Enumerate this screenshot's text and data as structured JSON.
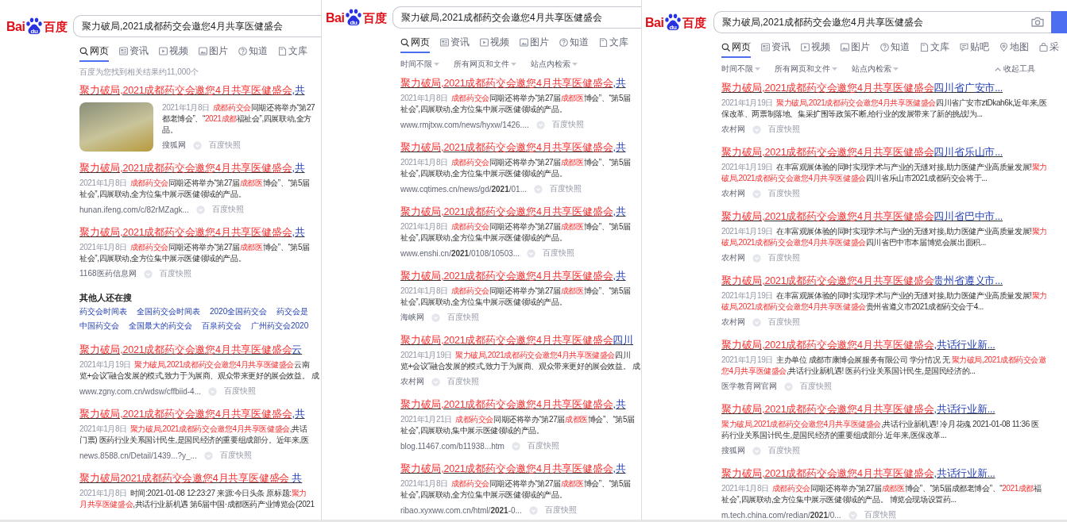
{
  "panels": [
    {
      "logo": {
        "latin": "Bai",
        "paw": "du",
        "chinese": "百度"
      },
      "search": {
        "value": "聚力破局,2021成都药交会邀您4月共享医健盛会"
      },
      "tabs": [
        {
          "label": "网页",
          "selected": true
        },
        {
          "label": "资讯",
          "selected": false
        },
        {
          "label": "视频",
          "selected": false
        },
        {
          "label": "图片",
          "selected": false
        },
        {
          "label": "知道",
          "selected": false
        },
        {
          "label": "文库",
          "selected": false
        }
      ],
      "result_count": "百度为您找到相关结果约11,000个",
      "items": [
        {
          "kind": "result",
          "title": [
            {
              "text": "聚力破局,2021成都药交会邀您4月共享医健盛会",
              "kind": "highlight"
            },
            {
              "text": ",共",
              "kind": "plain"
            }
          ],
          "thumbnail": true,
          "lines": [
            [
              {
                "text": "2021年1月8日",
                "kind": "date"
              },
              {
                "text": "成都药交会",
                "kind": "highlight"
              },
              {
                "text": "同期还将举办“第27",
                "kind": "plain"
              }
            ],
            [
              {
                "text": "都老博会”、“",
                "kind": "plain"
              },
              {
                "text": "2021成都",
                "kind": "highlight"
              },
              {
                "text": "福祉会”,四展联动,全方",
                "kind": "plain"
              }
            ],
            [
              {
                "text": "品。",
                "kind": "plain"
              }
            ]
          ],
          "source": "搜狐网",
          "snapshot": "百度快照"
        },
        {
          "kind": "result",
          "title": [
            {
              "text": "聚力破局,2021成都药交会邀您4月共享医健盛会",
              "kind": "highlight"
            },
            {
              "text": ",共",
              "kind": "plain"
            }
          ],
          "lines": [
            [
              {
                "text": "2021年1月8日",
                "kind": "date"
              },
              {
                "text": "成都药交会",
                "kind": "highlight"
              },
              {
                "text": "同期还将举办“第27届",
                "kind": "plain"
              },
              {
                "text": "成都医",
                "kind": "highlight"
              },
              {
                "text": "博会”、“第5届",
                "kind": "plain"
              }
            ],
            [
              {
                "text": "祉会”,四展联动,全方位集中展示医健领域的产品。",
                "kind": "plain"
              }
            ]
          ],
          "source": "hunan.ifeng.com/c/82rMZagk...",
          "snapshot": "百度快照"
        },
        {
          "kind": "result",
          "title": [
            {
              "text": "聚力破局,2021成都药交会邀您4月共享医健盛会",
              "kind": "highlight"
            },
            {
              "text": ",共",
              "kind": "plain"
            }
          ],
          "lines": [
            [
              {
                "text": "2021年1月8日",
                "kind": "date"
              },
              {
                "text": "成都药交会",
                "kind": "highlight"
              },
              {
                "text": "同期还将举办“第27届",
                "kind": "plain"
              },
              {
                "text": "成都医",
                "kind": "highlight"
              },
              {
                "text": "博会”、“第5届",
                "kind": "plain"
              }
            ],
            [
              {
                "text": "祉会”,四展联动,全方位集中展示医健领域的产品。",
                "kind": "plain"
              }
            ]
          ],
          "source": "1168医药信息网",
          "snapshot": "百度快照"
        },
        {
          "kind": "related",
          "heading": "其他人还在搜",
          "rows": [
            [
              "药交会时间表",
              "全国药交会时间表",
              "2020全国药交会",
              "药交会是"
            ],
            [
              "中国药交会",
              "全国最大的药交会",
              "百泉药交会",
              "广州药交会2020"
            ]
          ]
        },
        {
          "kind": "result",
          "title": [
            {
              "text": "聚力破局,2021成都药交会邀您4月共享医健盛会",
              "kind": "highlight"
            },
            {
              "text": "云",
              "kind": "plain"
            }
          ],
          "lines": [
            [
              {
                "text": "2021年1月19日",
                "kind": "date"
              },
              {
                "text": "聚力破局,2021成都药交会邀您4月共享医健盛会",
                "kind": "highlight"
              },
              {
                "text": "云南",
                "kind": "plain"
              }
            ],
            [
              {
                "text": "览+会议”融合发展的模式,致力于为展商、观众带来更好的展会效益。 成",
                "kind": "plain"
              }
            ]
          ],
          "source": "www.zgny.com.cn/wdsw/cffbiid-4...",
          "snapshot": "百度快照"
        },
        {
          "kind": "result",
          "title": [
            {
              "text": "聚力破局,2021成都药交会邀您4月共享医健盛会",
              "kind": "highlight"
            },
            {
              "text": ",共",
              "kind": "plain"
            }
          ],
          "lines": [
            [
              {
                "text": "2021年1月8日",
                "kind": "date"
              },
              {
                "text": "聚力破局,2021成都药交会邀您4月共享医健盛会",
                "kind": "highlight"
              },
              {
                "text": ",共话",
                "kind": "plain"
              }
            ],
            [
              {
                "text": "门票) 医药行业关系国计民生,是国民经济的重要组成部分。近年来,医",
                "kind": "plain"
              }
            ]
          ],
          "source": "news.8588.cn/Detail/1439...?y_...",
          "snapshot": "百度快照"
        },
        {
          "kind": "result",
          "title": [
            {
              "text": "聚力破局2021成都药交会邀您4月共享医健盛会",
              "kind": "highlight"
            },
            {
              "text": " 共",
              "kind": "plain"
            }
          ],
          "lines": [
            [
              {
                "text": "2021年1月8日",
                "kind": "date"
              },
              {
                "text": "时间:2021-01-08 12:23:27 来源:今日头条 原标题:",
                "kind": "plain"
              },
              {
                "text": "聚力",
                "kind": "highlight"
              }
            ],
            [
              {
                "text": "月共享医健盛会",
                "kind": "highlight"
              },
              {
                "text": ",共话行业新机遇 第6届中国·成都医药产业博览会(2021",
                "kind": "plain"
              }
            ]
          ]
        }
      ]
    },
    {
      "logo": {
        "latin": "Bai",
        "paw": "du",
        "chinese": "百度"
      },
      "search": {
        "value": "聚力破局,2021成都药交会邀您4月共享医健盛会"
      },
      "tabs": [
        {
          "label": "网页",
          "selected": true
        },
        {
          "label": "资讯",
          "selected": false
        },
        {
          "label": "视频",
          "selected": false
        },
        {
          "label": "图片",
          "selected": false
        },
        {
          "label": "知道",
          "selected": false
        },
        {
          "label": "文库",
          "selected": false
        }
      ],
      "filters": [
        "时间不限",
        "所有网页和文件",
        "站点内检索"
      ],
      "items": [
        {
          "kind": "result",
          "title": [
            {
              "text": "聚力破局,2021成都药交会邀您4月共享医健盛会",
              "kind": "highlight"
            },
            {
              "text": ",共",
              "kind": "plain"
            }
          ],
          "lines": [
            [
              {
                "text": "2021年1月8日",
                "kind": "date"
              },
              {
                "text": "成都药交会",
                "kind": "highlight"
              },
              {
                "text": "同期还将举办“第27届",
                "kind": "plain"
              },
              {
                "text": "成都医",
                "kind": "highlight"
              },
              {
                "text": "博会”、“第5届",
                "kind": "plain"
              }
            ],
            [
              {
                "text": "祉会”,四展联动,全方位集中展示医健领域的产品。",
                "kind": "plain"
              }
            ]
          ],
          "source": "www.rmjtxw.com/news/hyxw/1426....",
          "snapshot": "百度快照"
        },
        {
          "kind": "result",
          "title": [
            {
              "text": "聚力破局,2021成都药交会邀您4月共享医健盛会",
              "kind": "highlight"
            },
            {
              "text": ",共",
              "kind": "plain"
            }
          ],
          "lines": [
            [
              {
                "text": "2021年1月8日",
                "kind": "date"
              },
              {
                "text": "成都药交会",
                "kind": "highlight"
              },
              {
                "text": "同期还将举办“第27届",
                "kind": "plain"
              },
              {
                "text": "成都医",
                "kind": "highlight"
              },
              {
                "text": "博会”、“第5届",
                "kind": "plain"
              }
            ],
            [
              {
                "text": "祉会”,四展联动,全方位集中展示医健领域的产品。",
                "kind": "plain"
              }
            ]
          ],
          "source": "www.cqtimes.cn/news/gd/**2021**/01...",
          "snapshot": "百度快照"
        },
        {
          "kind": "result",
          "title": [
            {
              "text": "聚力破局,2021成都药交会邀您4月共享医健盛会",
              "kind": "highlight"
            },
            {
              "text": ",共",
              "kind": "plain"
            }
          ],
          "lines": [
            [
              {
                "text": "2021年1月8日",
                "kind": "date"
              },
              {
                "text": "成都药交会",
                "kind": "highlight"
              },
              {
                "text": "同期还将举办“第27届",
                "kind": "plain"
              },
              {
                "text": "成都医",
                "kind": "highlight"
              },
              {
                "text": "博会”、“第5届",
                "kind": "plain"
              }
            ],
            [
              {
                "text": "祉会”,四展联动,全方位集中展示医健领域的产品。",
                "kind": "plain"
              }
            ]
          ],
          "source": "www.enshi.cn/**2021**/0108/10503...",
          "snapshot": "百度快照"
        },
        {
          "kind": "result",
          "title": [
            {
              "text": "聚力破局,2021成都药交会邀您4月共享医健盛会",
              "kind": "highlight"
            },
            {
              "text": ",共",
              "kind": "plain"
            }
          ],
          "lines": [
            [
              {
                "text": "2021年1月8日",
                "kind": "date"
              },
              {
                "text": "成都药交会",
                "kind": "highlight"
              },
              {
                "text": "同期还将举办“第27届",
                "kind": "plain"
              },
              {
                "text": "成都医",
                "kind": "highlight"
              },
              {
                "text": "博会”、“第5届",
                "kind": "plain"
              }
            ],
            [
              {
                "text": "祉会”,四展联动,全方位集中展示医健领域的产品。",
                "kind": "plain"
              }
            ]
          ],
          "source": "海峡网",
          "snapshot": "百度快照"
        },
        {
          "kind": "result",
          "title": [
            {
              "text": "聚力破局,2021成都药交会邀您4月共享医健盛会",
              "kind": "highlight"
            },
            {
              "text": "四川",
              "kind": "plain"
            }
          ],
          "lines": [
            [
              {
                "text": "2021年1月19日",
                "kind": "date"
              },
              {
                "text": "聚力破局,2021成都药交会邀您4月共享医健盛会",
                "kind": "highlight"
              },
              {
                "text": "四川",
                "kind": "plain"
              }
            ],
            [
              {
                "text": "览+会议”融合发展的模式,致力于为展商、观众带来更好的展会效益。 成",
                "kind": "plain"
              }
            ]
          ],
          "source": "农村网",
          "snapshot": "百度快照"
        },
        {
          "kind": "result",
          "title": [
            {
              "text": "聚力破局,2021成都药交会邀您4月共享医健盛会",
              "kind": "highlight"
            },
            {
              "text": ",共",
              "kind": "plain"
            }
          ],
          "lines": [
            [
              {
                "text": "2021年1月21日",
                "kind": "date"
              },
              {
                "text": "成都药交会",
                "kind": "highlight"
              },
              {
                "text": "同期还将举办“第27届",
                "kind": "plain"
              },
              {
                "text": "成都医",
                "kind": "highlight"
              },
              {
                "text": "博会”、“第5届",
                "kind": "plain"
              }
            ],
            [
              {
                "text": "祉会”,四展联动,集中展示医健领域的产品。",
                "kind": "plain"
              }
            ]
          ],
          "source": "blog.11467.com/b11938...htm",
          "snapshot": "百度快照"
        },
        {
          "kind": "result",
          "title": [
            {
              "text": "聚力破局,2021成都药交会邀您4月共享医健盛会",
              "kind": "highlight"
            },
            {
              "text": ",共",
              "kind": "plain"
            }
          ],
          "lines": [
            [
              {
                "text": "2021年1月8日",
                "kind": "date"
              },
              {
                "text": "成都药交会",
                "kind": "highlight"
              },
              {
                "text": "同期还将举办“第27届",
                "kind": "plain"
              },
              {
                "text": "成都医",
                "kind": "highlight"
              },
              {
                "text": "博会”、“第5届",
                "kind": "plain"
              }
            ],
            [
              {
                "text": "祉会”,四展联动,全方位集中展示医健领域的产品。",
                "kind": "plain"
              }
            ]
          ],
          "source": "ribao.xyxww.com.cn/html/**2021**-0...",
          "snapshot": "百度快照"
        }
      ]
    },
    {
      "logo": {
        "latin": "Bai",
        "paw": "du",
        "chinese": "百度"
      },
      "search": {
        "value": "聚力破局,2021成都药交会邀您4月共享医健盛会",
        "camera": true,
        "button": true
      },
      "tabs": [
        {
          "label": "网页",
          "selected": true
        },
        {
          "label": "资讯",
          "selected": false
        },
        {
          "label": "视频",
          "selected": false
        },
        {
          "label": "图片",
          "selected": false
        },
        {
          "label": "知道",
          "selected": false
        },
        {
          "label": "文库",
          "selected": false
        },
        {
          "label": "贴吧",
          "selected": false
        },
        {
          "label": "地图",
          "selected": false
        },
        {
          "label": "采",
          "selected": false
        }
      ],
      "filters": [
        "时间不限",
        "所有网页和文件",
        "站点内检索"
      ],
      "collapse_tools": "收起工具",
      "items": [
        {
          "kind": "result",
          "title": [
            {
              "text": "聚力破局,2021成都药交会邀您4月共享医健盛会",
              "kind": "highlight"
            },
            {
              "text": "四川省广安市...",
              "kind": "plain"
            }
          ],
          "lines": [
            [
              {
                "text": "2021年1月19日",
                "kind": "date"
              },
              {
                "text": "聚力破局,2021成都药交会邀您4月共享医健盛会",
                "kind": "highlight"
              },
              {
                "text": "四川省广安市ztDkah6k,近年来,医",
                "kind": "plain"
              }
            ],
            [
              {
                "text": "保改革、两票制落地、集采扩围等政策不断,给行业的发展带来了新的挑战!为...",
                "kind": "plain"
              }
            ]
          ],
          "source": "农村网",
          "snapshot": "百度快照"
        },
        {
          "kind": "result",
          "title": [
            {
              "text": "聚力破局,2021成都药交会邀您4月共享医健盛会",
              "kind": "highlight"
            },
            {
              "text": "四川省乐山市...",
              "kind": "plain"
            }
          ],
          "lines": [
            [
              {
                "text": "2021年1月19日",
                "kind": "date"
              },
              {
                "text": "在丰富观展体验的同时实现学术与产业的无缝对接,助力医健产业高质量发展!",
                "kind": "plain"
              },
              {
                "text": "聚力",
                "kind": "highlight"
              }
            ],
            [
              {
                "text": "破局,2021成都药交会邀您4月共享医健盛会",
                "kind": "highlight"
              },
              {
                "text": "四川省乐山市2021成都药交会将于...",
                "kind": "plain"
              }
            ]
          ],
          "source": "农村网",
          "snapshot": "百度快照"
        },
        {
          "kind": "result",
          "title": [
            {
              "text": "聚力破局,2021成都药交会邀您4月共享医健盛会",
              "kind": "highlight"
            },
            {
              "text": "四川省巴中市...",
              "kind": "plain"
            }
          ],
          "lines": [
            [
              {
                "text": "2021年1月19日",
                "kind": "date"
              },
              {
                "text": "在丰富观展体验的同时实现学术与产业的无缝对接,助力医健产业高质量发展!",
                "kind": "plain"
              },
              {
                "text": "聚力",
                "kind": "highlight"
              }
            ],
            [
              {
                "text": "破局,2021成都药交会邀您4月共享医健盛会",
                "kind": "highlight"
              },
              {
                "text": "四川省巴中市本届博览会展出面积...",
                "kind": "plain"
              }
            ]
          ],
          "source": "农村网",
          "snapshot": "百度快照"
        },
        {
          "kind": "result",
          "title": [
            {
              "text": "聚力破局,2021成都药交会邀您4月共享医健盛会",
              "kind": "highlight"
            },
            {
              "text": "贵州省遵义市...",
              "kind": "plain"
            }
          ],
          "lines": [
            [
              {
                "text": "2021年1月19日",
                "kind": "date"
              },
              {
                "text": "在丰富观展体验的同时实现学术与产业的无缝对接,助力医健产业高质量发展!",
                "kind": "plain"
              },
              {
                "text": "聚力",
                "kind": "highlight"
              }
            ],
            [
              {
                "text": "破局,2021成都药交会邀您4月共享医健盛会",
                "kind": "highlight"
              },
              {
                "text": "贵州省遵义市2021成都药交会于4...",
                "kind": "plain"
              }
            ]
          ],
          "source": "农村网",
          "snapshot": "百度快照"
        },
        {
          "kind": "result",
          "title": [
            {
              "text": "聚力破局,2021成都药交会邀您4月共享医健盛会",
              "kind": "highlight"
            },
            {
              "text": ",共话行业新...",
              "kind": "plain"
            }
          ],
          "lines": [
            [
              {
                "text": "2021年1月19日",
                "kind": "date"
              },
              {
                "text": "主办单位 成都市康博会展服务有限公司 学分情况 无 ",
                "kind": "plain"
              },
              {
                "text": "聚力破局,2021成都药交会邀",
                "kind": "highlight"
              }
            ],
            [
              {
                "text": "您4月共享医健盛会",
                "kind": "highlight"
              },
              {
                "text": ",共话行业新机遇! 医药行业关系国计民生,是国民经济的...",
                "kind": "plain"
              }
            ]
          ],
          "source": "医学教育网官网",
          "snapshot": "百度快照"
        },
        {
          "kind": "result",
          "title": [
            {
              "text": "聚力破局,2021成都药交会邀您4月共享医健盛会",
              "kind": "highlight"
            },
            {
              "text": ",共话行业新...",
              "kind": "plain"
            }
          ],
          "lines": [
            [
              {
                "text": "聚力破局,2021成都药交会邀您4月共享医健盛会",
                "kind": "highlight"
              },
              {
                "text": ",共话行业新机遇! 冷月花魂 2021-01-08 11:36 医",
                "kind": "plain"
              }
            ],
            [
              {
                "text": "药行业关系国计民生,是国民经济的重要组成部分.近年来,医保改革...",
                "kind": "plain"
              }
            ]
          ],
          "source": "搜狐网",
          "snapshot": "百度快照"
        },
        {
          "kind": "result",
          "title": [
            {
              "text": "聚力破局,2021成都药交会邀您4月共享医健盛会",
              "kind": "highlight"
            },
            {
              "text": ",共话行业新...",
              "kind": "plain"
            }
          ],
          "lines": [
            [
              {
                "text": "2021年1月8日",
                "kind": "date"
              },
              {
                "text": "成都药交会",
                "kind": "highlight"
              },
              {
                "text": "同期还将举办“第27届",
                "kind": "plain"
              },
              {
                "text": "成都医",
                "kind": "highlight"
              },
              {
                "text": "博会”、“第5届成都老博会”、“",
                "kind": "plain"
              },
              {
                "text": "2021成都",
                "kind": "highlight"
              },
              {
                "text": "福",
                "kind": "plain"
              }
            ],
            [
              {
                "text": "祉会”,四展联动,全方位集中展示医健领域的产品。 博览会现场设置药...",
                "kind": "plain"
              }
            ]
          ],
          "source": "m.tech.china.com/redian/**2021**/0...",
          "snapshot": "百度快照"
        }
      ]
    }
  ]
}
